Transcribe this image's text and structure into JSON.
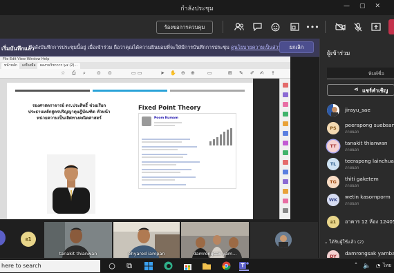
{
  "window": {
    "title": "กำลังประชุม"
  },
  "toolbar": {
    "request_control": "ร้องขอการควบคุม"
  },
  "banner": {
    "lead": "เริ่มบันทึกแล้ว",
    "message": "กำลังบันทึกการประชุมนี้อยู่ เมื่อเข้าร่วม ถือว่าคุณได้ความยินยอมที่จะให้มีการบันทึกการประชุม",
    "link": "ดูนโยบายความเป็นส่วนตัว",
    "dismiss": "ยกเลิก"
  },
  "shared_screen": {
    "menu": "File   Edit   View   Window   Help",
    "tabs": [
      "หน้าหลัก",
      "เครื่องมือ",
      "ผลงานวิชาการ ๖๔ (2)..."
    ],
    "slide": {
      "thai_title": "รองศาสตราจารย์ ดร.ประสิทธิ์ ช่วยเรียก ประธานหลักสูตรปริญญาดุษฎีบัณฑิต หัวหน้าหน่วยความเป็นเลิศทางคณิตศาสตร์",
      "right_title": "Fixed Point Theory",
      "scholar_name": "Poom Kumam"
    }
  },
  "participants": {
    "title": "ผู้เข้าร่วม",
    "search_placeholder": "พิมพ์ชื่อ",
    "share_invite": "แชร์คำเชิญ",
    "list": [
      {
        "initials": "",
        "name": "jirayu_sae",
        "role": "",
        "color": "#ffffff"
      },
      {
        "initials": "PS",
        "name": "peerapong suebsan",
        "role": "ภายนอก",
        "color": "#f3d9b1"
      },
      {
        "initials": "TT",
        "name": "tanakit thianwan",
        "role": "ภายนอก",
        "color": "#f6d2d2"
      },
      {
        "initials": "TL",
        "name": "teerapong lainchua",
        "role": "ภายนอก",
        "color": "#cfe3f4"
      },
      {
        "initials": "TG",
        "name": "thiti gaketem",
        "role": "ภายนอก",
        "color": "#f9dcc4"
      },
      {
        "initials": "WK",
        "name": "wetin kasornporm",
        "role": "ภายนอก",
        "color": "#d6dcf2"
      },
      {
        "initials": "อ1",
        "name": "อาคาร 12 ห้อง 12405",
        "role": "",
        "color": "#e8d58a"
      }
    ],
    "invited_label": "ได้รับผู้ใช้แล้ว (2)",
    "extra": {
      "initials": "DY",
      "name": "damrongsak yambang"
    }
  },
  "video_strip": {
    "side_badge": "อ1",
    "tiles": [
      "tanakit thianwan",
      "ehyared iampan",
      "damrongsak yam...",
      ""
    ]
  },
  "taskbar": {
    "search_text": "here to search",
    "lang": "ไทย"
  }
}
